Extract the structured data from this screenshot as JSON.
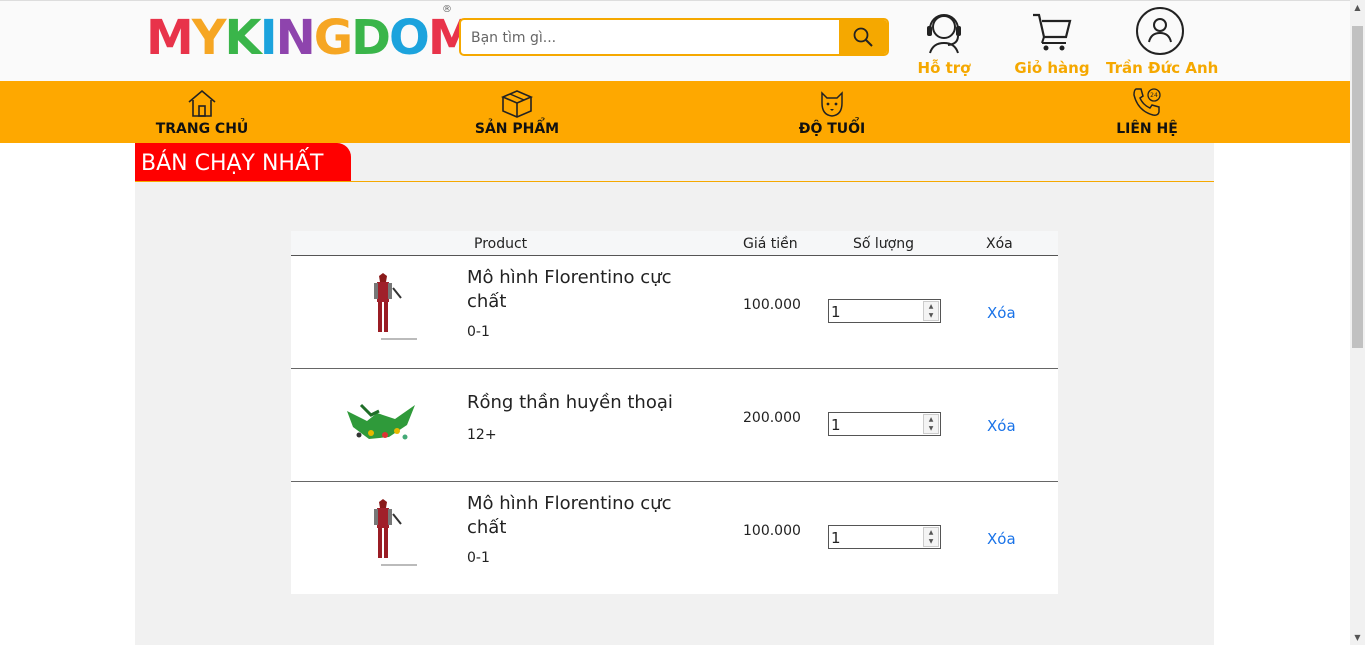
{
  "brand": {
    "logo_text": "MYKINGDOM",
    "reg": "®"
  },
  "search": {
    "placeholder": "Bạn tìm gì..."
  },
  "header_actions": [
    {
      "label": "Hỗ trợ",
      "icon": "headset-icon"
    },
    {
      "label": "Giỏ hàng",
      "icon": "cart-icon"
    },
    {
      "label": "Trần Đức Anh",
      "icon": "user-icon"
    }
  ],
  "nav": [
    {
      "label": "TRANG CHỦ",
      "icon": "home-icon"
    },
    {
      "label": "SẢN PHẨM",
      "icon": "box-icon"
    },
    {
      "label": "ĐỘ TUỔI",
      "icon": "dog-icon"
    },
    {
      "label": "LIÊN HỆ",
      "icon": "phone-icon"
    }
  ],
  "section": {
    "title": "BÁN CHẠY NHẤT"
  },
  "cart": {
    "headers": {
      "product": "Product",
      "price": "Giá tiền",
      "qty": "Số lượng",
      "remove": "Xóa"
    },
    "rows": [
      {
        "name": "Mô hình Florentino cực chất",
        "age": "0-1",
        "price": "100.000",
        "qty": "1",
        "remove": "Xóa",
        "image": "robot-figure"
      },
      {
        "name": "Rồng thần huyền thoại",
        "age": "12+",
        "price": "200.000",
        "qty": "1",
        "remove": "Xóa",
        "image": "green-dragon-lego"
      },
      {
        "name": "Mô hình Florentino cực chất",
        "age": "0-1",
        "price": "100.000",
        "qty": "1",
        "remove": "Xóa",
        "image": "robot-figure"
      }
    ]
  },
  "colors": {
    "accent": "#fea800",
    "section_red": "#ff0000",
    "link": "#1a73e8"
  }
}
